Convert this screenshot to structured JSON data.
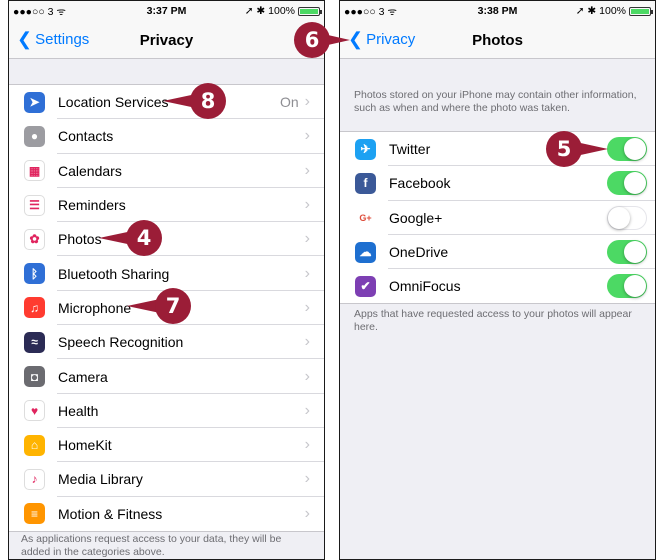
{
  "left": {
    "status": {
      "carrier": "●●●○○ 3 ᯤ",
      "time": "3:37 PM",
      "battery": "➚ ✱ 100%"
    },
    "nav": {
      "back": "Settings",
      "title": "Privacy"
    },
    "items": [
      {
        "label": "Location Services",
        "value": "On",
        "icon": "location-arrow-icon",
        "color": "#2f6fd6",
        "glyph": "➤"
      },
      {
        "label": "Contacts",
        "value": "",
        "icon": "contacts-icon",
        "color": "#9c9ca1",
        "glyph": "●"
      },
      {
        "label": "Calendars",
        "value": "",
        "icon": "calendar-icon",
        "color": "#ffffff",
        "glyph": "▦"
      },
      {
        "label": "Reminders",
        "value": "",
        "icon": "reminders-icon",
        "color": "#ffffff",
        "glyph": "☰"
      },
      {
        "label": "Photos",
        "value": "",
        "icon": "photos-flower-icon",
        "color": "#ffffff",
        "glyph": "✿"
      },
      {
        "label": "Bluetooth Sharing",
        "value": "",
        "icon": "bluetooth-icon",
        "color": "#2f6fd6",
        "glyph": "ᛒ"
      },
      {
        "label": "Microphone",
        "value": "",
        "icon": "microphone-icon",
        "color": "#ff3b30",
        "glyph": "♫"
      },
      {
        "label": "Speech Recognition",
        "value": "",
        "icon": "siri-icon",
        "color": "#2b2b55",
        "glyph": "≈"
      },
      {
        "label": "Camera",
        "value": "",
        "icon": "camera-icon",
        "color": "#6b6b70",
        "glyph": "◘"
      },
      {
        "label": "Health",
        "value": "",
        "icon": "health-heart-icon",
        "color": "#ffffff",
        "glyph": "♥"
      },
      {
        "label": "HomeKit",
        "value": "",
        "icon": "homekit-icon",
        "color": "#ffb400",
        "glyph": "⌂"
      },
      {
        "label": "Media Library",
        "value": "",
        "icon": "music-note-icon",
        "color": "#ffffff",
        "glyph": "♪"
      },
      {
        "label": "Motion & Fitness",
        "value": "",
        "icon": "motion-fitness-icon",
        "color": "#ff9500",
        "glyph": "≡"
      }
    ],
    "footer": "As applications request access to your data, they will be added in the categories above."
  },
  "right": {
    "status": {
      "carrier": "●●●○○ 3 ᯤ",
      "time": "3:38 PM",
      "battery": "➚ ✱ 100%"
    },
    "nav": {
      "back": "Privacy",
      "title": "Photos"
    },
    "header": "Photos stored on your iPhone may contain other information, such as when and where the photo was taken.",
    "apps": [
      {
        "label": "Twitter",
        "on": true,
        "icon": "twitter-bird-icon",
        "color": "#1da1f2",
        "glyph": "✈"
      },
      {
        "label": "Facebook",
        "on": true,
        "icon": "facebook-icon",
        "color": "#3b5998",
        "glyph": "f"
      },
      {
        "label": "Google+",
        "on": false,
        "icon": "google-plus-icon",
        "color": "#dd4b39",
        "glyph": "G+"
      },
      {
        "label": "OneDrive",
        "on": true,
        "icon": "onedrive-cloud-icon",
        "color": "#1e6fd0",
        "glyph": "☁"
      },
      {
        "label": "OmniFocus",
        "on": true,
        "icon": "omnifocus-check-icon",
        "color": "#7d3fb3",
        "glyph": "✔"
      }
    ],
    "footer": "Apps that have requested access to your photos will appear here."
  },
  "callouts": {
    "c4": "4",
    "c5": "5",
    "c6": "6",
    "c7": "7",
    "c8": "8"
  },
  "colors": {
    "callout": "#9b1d37",
    "accent": "#007aff",
    "toggle_on": "#4cd964"
  }
}
